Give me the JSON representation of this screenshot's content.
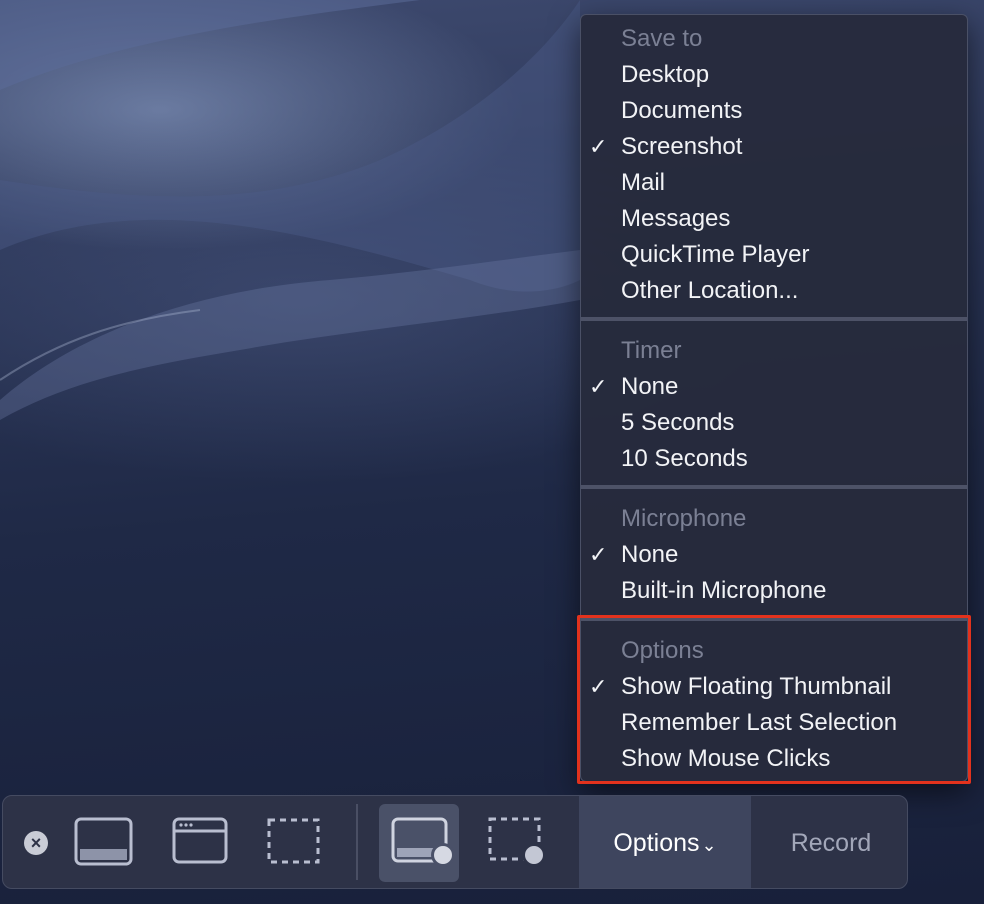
{
  "menu": {
    "sections": [
      {
        "header": "Save to",
        "items": [
          {
            "label": "Desktop",
            "checked": false
          },
          {
            "label": "Documents",
            "checked": false
          },
          {
            "label": "Screenshot",
            "checked": true
          },
          {
            "label": "Mail",
            "checked": false
          },
          {
            "label": "Messages",
            "checked": false
          },
          {
            "label": "QuickTime Player",
            "checked": false
          },
          {
            "label": "Other Location...",
            "checked": false
          }
        ]
      },
      {
        "header": "Timer",
        "items": [
          {
            "label": "None",
            "checked": true
          },
          {
            "label": "5 Seconds",
            "checked": false
          },
          {
            "label": "10 Seconds",
            "checked": false
          }
        ]
      },
      {
        "header": "Microphone",
        "items": [
          {
            "label": "None",
            "checked": true
          },
          {
            "label": "Built-in Microphone",
            "checked": false
          }
        ]
      },
      {
        "header": "Options",
        "items": [
          {
            "label": "Show Floating Thumbnail",
            "checked": true
          },
          {
            "label": "Remember Last Selection",
            "checked": false
          },
          {
            "label": "Show Mouse Clicks",
            "checked": false
          }
        ]
      }
    ],
    "check_glyph": "✓"
  },
  "toolbar": {
    "close_glyph": "×",
    "buttons": [
      {
        "name": "capture-entire-screen",
        "icon": "screen-icon",
        "selected": false
      },
      {
        "name": "capture-selected-window",
        "icon": "window-icon",
        "selected": false
      },
      {
        "name": "capture-selected-portion",
        "icon": "dashed-selection-icon",
        "selected": false
      },
      {
        "name": "record-entire-screen",
        "icon": "screen-record-icon",
        "selected": true
      },
      {
        "name": "record-selected-portion",
        "icon": "selection-record-icon",
        "selected": false
      }
    ],
    "options_label": "Options",
    "options_chevron": "⌄",
    "record_label": "Record"
  },
  "colors": {
    "highlight": "#e2321d",
    "menu_bg": "#262b3c",
    "toolbar_bg": "#2d3247"
  }
}
